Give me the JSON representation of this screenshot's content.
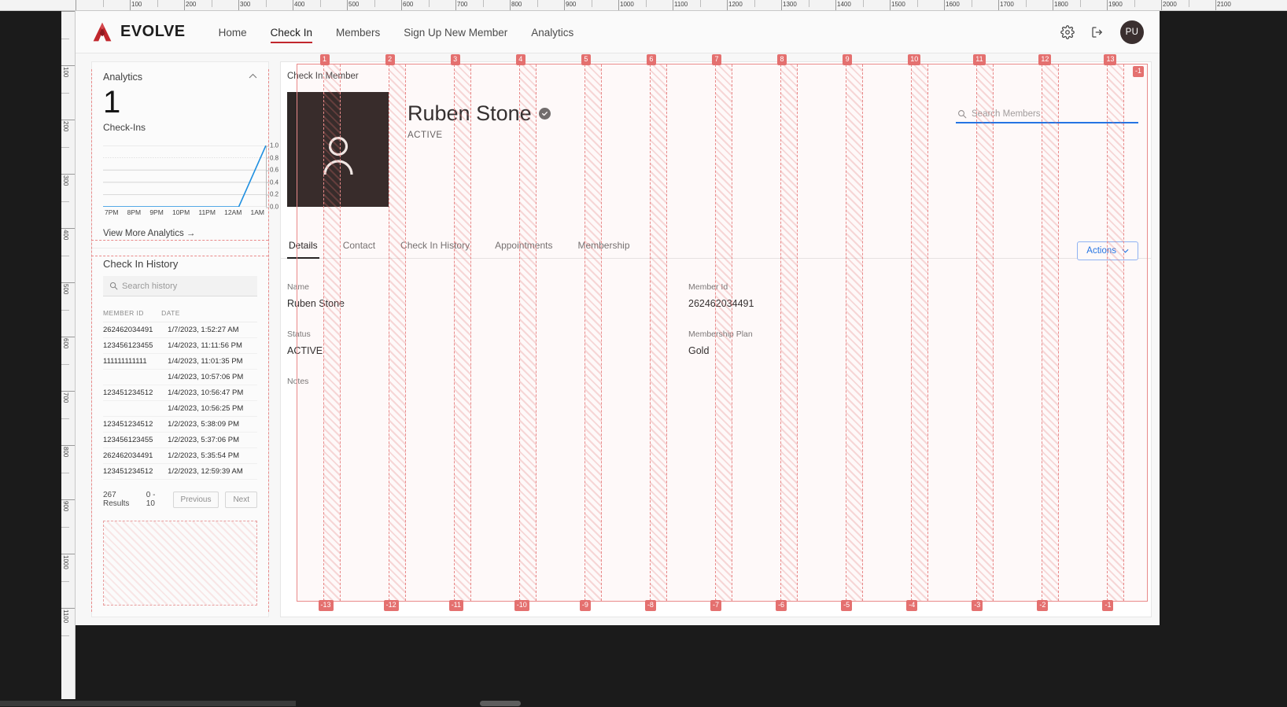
{
  "app": {
    "brand": "EVOLVE",
    "brand_color": "#c1272d",
    "nav": [
      {
        "label": "Home",
        "active": false
      },
      {
        "label": "Check In",
        "active": true
      },
      {
        "label": "Members",
        "active": false
      },
      {
        "label": "Sign Up New Member",
        "active": false
      },
      {
        "label": "Analytics",
        "active": false
      }
    ],
    "header_icons": [
      {
        "name": "gear-icon"
      },
      {
        "name": "logout-icon"
      }
    ],
    "avatar_initials": "PU"
  },
  "sidebar": {
    "analytics": {
      "title": "Analytics",
      "collapse_icon": "chevron-up-icon",
      "metric_value": "1",
      "metric_label": "Check-Ins",
      "view_more": "View More Analytics  →"
    },
    "check_in_history": {
      "title": "Check In History",
      "search_placeholder": "Search history",
      "search_icon": "search-icon",
      "columns": [
        "MEMBER ID",
        "DATE"
      ],
      "rows": [
        {
          "member_id": "262462034491",
          "date": "1/7/2023, 1:52:27 AM"
        },
        {
          "member_id": "123456123455",
          "date": "1/4/2023, 11:11:56 PM"
        },
        {
          "member_id": "111111111111",
          "date": "1/4/2023, 11:01:35 PM"
        },
        {
          "member_id": "",
          "date": "1/4/2023, 10:57:06 PM"
        },
        {
          "member_id": "123451234512",
          "date": "1/4/2023, 10:56:47 PM"
        },
        {
          "member_id": "",
          "date": "1/4/2023, 10:56:25 PM"
        },
        {
          "member_id": "123451234512",
          "date": "1/2/2023, 5:38:09 PM"
        },
        {
          "member_id": "123456123455",
          "date": "1/2/2023, 5:37:06 PM"
        },
        {
          "member_id": "262462034491",
          "date": "1/2/2023, 5:35:54 PM"
        },
        {
          "member_id": "123451234512",
          "date": "1/2/2023, 12:59:39 AM"
        }
      ],
      "results_text": "267 Results",
      "range_text": "0 - 10",
      "prev_label": "Previous",
      "next_label": "Next"
    }
  },
  "main": {
    "page_label": "Check In Member",
    "member": {
      "name": "Ruben Stone",
      "verified_icon": "check-badge-icon",
      "status": "ACTIVE",
      "photo_icon": "person-avatar-icon"
    },
    "search": {
      "placeholder": "Search Members",
      "icon": "search-icon",
      "focus_color": "#1a73e8"
    },
    "tabs": [
      {
        "label": "Details",
        "active": true
      },
      {
        "label": "Contact",
        "active": false
      },
      {
        "label": "Check In History",
        "active": false
      },
      {
        "label": "Appointments",
        "active": false
      },
      {
        "label": "Membership",
        "active": false
      }
    ],
    "actions_button": {
      "label": "Actions",
      "icon": "chevron-down-icon",
      "color": "#1a73e8"
    },
    "details": {
      "left": [
        {
          "label": "Name",
          "value": "Ruben Stone"
        },
        {
          "label": "Status",
          "value": "ACTIVE"
        },
        {
          "label": "Notes",
          "value": ""
        }
      ],
      "right": [
        {
          "label": "Member Id",
          "value": "262462034491"
        },
        {
          "label": "Membership Plan",
          "value": "Gold"
        }
      ]
    }
  },
  "chart_data": {
    "type": "line",
    "title": "Check-Ins",
    "xlabel": "",
    "ylabel": "",
    "categories": [
      "7PM",
      "8PM",
      "9PM",
      "10PM",
      "11PM",
      "12AM",
      "1AM"
    ],
    "values": [
      0,
      0,
      0,
      0,
      0,
      0,
      1
    ],
    "ylim": [
      0,
      1
    ],
    "yticks": [
      "0.0",
      "0.2",
      "0.4",
      "0.6",
      "0.8",
      "1.0"
    ],
    "series": [
      {
        "name": "Check-Ins",
        "values": [
          0,
          0,
          0,
          0,
          0,
          0,
          1
        ],
        "color": "#1f8fe0"
      }
    ],
    "grid": true,
    "legend": "none"
  },
  "devtools_grid": {
    "top_numbers": [
      "1",
      "2",
      "3",
      "4",
      "5",
      "6",
      "7",
      "8",
      "9",
      "10",
      "11",
      "12",
      "13"
    ],
    "bottom_numbers": [
      "-13",
      "-12",
      "-11",
      "-10",
      "-9",
      "-8",
      "-7",
      "-6",
      "-5",
      "-4",
      "-3",
      "-2",
      "-1"
    ],
    "extra_top_right": "-1",
    "line_color": "#e98a8a"
  },
  "rulers": {
    "top_labels": [
      "100",
      "200",
      "300",
      "400",
      "500",
      "600",
      "700",
      "800",
      "900",
      "1000",
      "1100",
      "1200",
      "1300",
      "1400",
      "1500",
      "1600",
      "1700",
      "1800",
      "1900",
      "2000"
    ],
    "left_labels": [
      "100",
      "200",
      "300",
      "400",
      "500",
      "600",
      "700",
      "800",
      "900",
      "1000",
      "1100"
    ]
  }
}
